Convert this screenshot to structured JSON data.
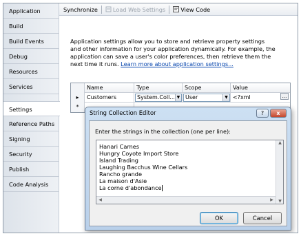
{
  "sidebar": {
    "tabs": [
      {
        "label": "Application"
      },
      {
        "label": "Build"
      },
      {
        "label": "Build Events"
      },
      {
        "label": "Debug"
      },
      {
        "label": "Resources"
      },
      {
        "label": "Services"
      },
      {
        "label": "Settings",
        "active": true
      },
      {
        "label": "Reference Paths"
      },
      {
        "label": "Signing"
      },
      {
        "label": "Security"
      },
      {
        "label": "Publish"
      },
      {
        "label": "Code Analysis"
      }
    ]
  },
  "toolbar": {
    "synchronize": "Synchronize",
    "load_web_settings": "Load Web Settings",
    "view_code": "View Code"
  },
  "description": {
    "text": "Application settings allow you to store and retrieve property settings and other information for your application dynamically. For example, the application can save a user's color preferences, then retrieve them the next time it runs. ",
    "link": "Learn more about application settings..."
  },
  "grid": {
    "headers": [
      "Name",
      "Type",
      "Scope",
      "Value"
    ],
    "row": {
      "name": "Customers",
      "type": "System.Coll...",
      "scope": "User",
      "value": "<?xml"
    },
    "new_row_marker": "*"
  },
  "dialog": {
    "title": "String Collection Editor",
    "help": "?",
    "close": "x",
    "prompt": "Enter the strings in the collection (one per line):",
    "lines": [
      "Hanari Carnes",
      "Hungry Coyote Import Store",
      "Island Trading",
      "Laughing Bacchus Wine Cellars",
      "Rancho grande",
      "La maison d'Asie",
      "La corne d'abondance"
    ],
    "ok": "OK",
    "cancel": "Cancel"
  }
}
